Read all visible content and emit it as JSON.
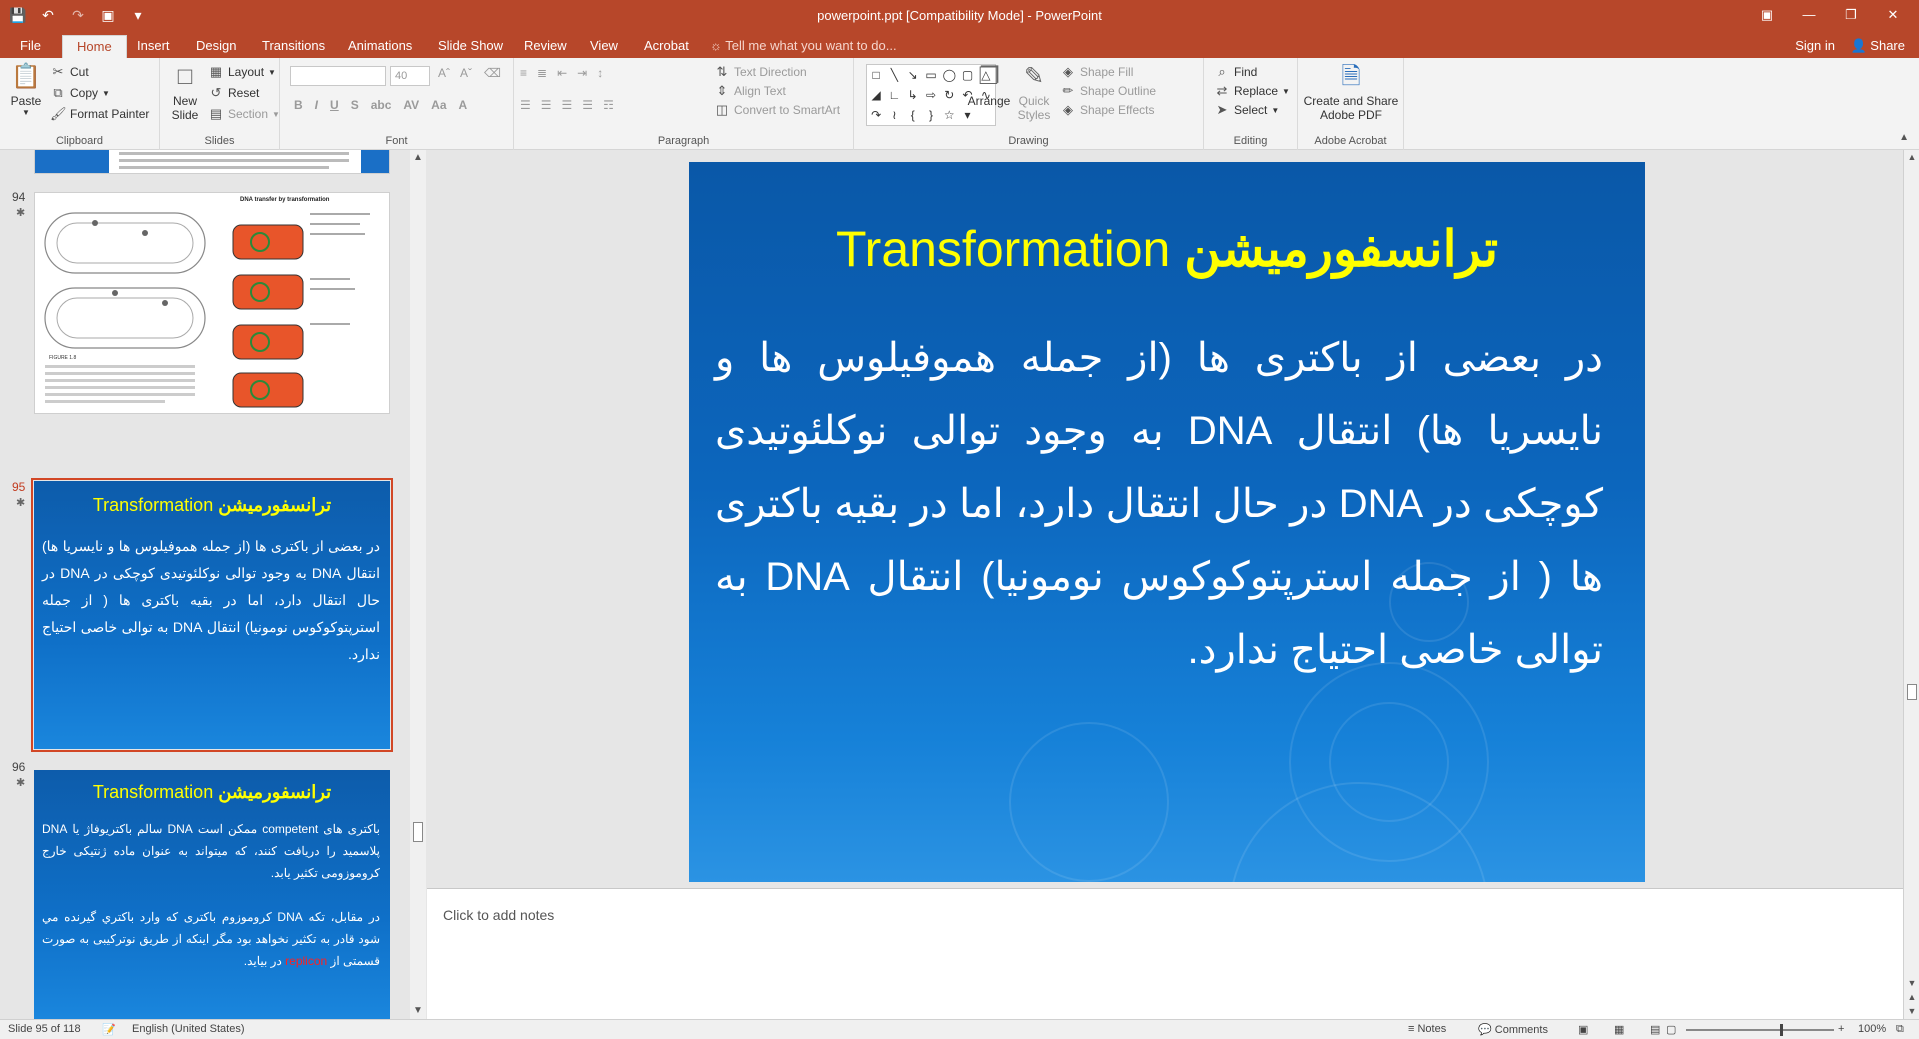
{
  "window": {
    "title": "powerpoint.ppt [Compatibility Mode] - PowerPoint",
    "qat": [
      "save-icon",
      "undo-icon",
      "redo-icon",
      "slideshow-icon",
      "customize-icon"
    ]
  },
  "tabs": {
    "items": [
      "File",
      "Home",
      "Insert",
      "Design",
      "Transitions",
      "Animations",
      "Slide Show",
      "Review",
      "View",
      "Acrobat"
    ],
    "active": "Home",
    "tell_me": "Tell me what you want to do...",
    "sign_in": "Sign in",
    "share": "Share"
  },
  "ribbon": {
    "clipboard": {
      "label": "Clipboard",
      "paste": "Paste",
      "cut": "Cut",
      "copy": "Copy",
      "format_painter": "Format Painter"
    },
    "slides": {
      "label": "Slides",
      "new_slide_line1": "New",
      "new_slide_line2": "Slide",
      "layout": "Layout",
      "reset": "Reset",
      "section": "Section"
    },
    "font": {
      "label": "Font",
      "font_size": "40"
    },
    "paragraph": {
      "label": "Paragraph",
      "text_direction": "Text Direction",
      "align_text": "Align Text",
      "convert_smartart": "Convert to SmartArt"
    },
    "drawing": {
      "label": "Drawing",
      "arrange": "Arrange",
      "quick_styles_line1": "Quick",
      "quick_styles_line2": "Styles",
      "shape_fill": "Shape Fill",
      "shape_outline": "Shape Outline",
      "shape_effects": "Shape Effects"
    },
    "editing": {
      "label": "Editing",
      "find": "Find",
      "replace": "Replace",
      "select": "Select"
    },
    "acrobat": {
      "label": "Adobe Acrobat",
      "create_line1": "Create and Share",
      "create_line2": "Adobe PDF"
    }
  },
  "thumbnails": {
    "slide94": {
      "number": "94",
      "title": "DNA transfer by transformation",
      "figure_label": "FIGURE 1.8"
    },
    "slide95": {
      "number": "95",
      "title_fa": "ترانسفورميشن",
      "title_en": "Transformation",
      "body": "در بعضی از باکتری ها (از جمله هموفیلوس ها و نایسریا ها) انتقال DNA به وجود توالی نوکلئوتیدی کوچکی در DNA در حال انتقال دارد، اما در بقیه باکتری ها ( از جمله استرپتوکوکوس نومونیا) انتقال DNA به توالی خاصی احتیاج ندارد."
    },
    "slide96": {
      "number": "96",
      "title_fa": "ترانسفورميشن",
      "title_en": "Transformation",
      "para1": "باکتری های competent ممکن است DNA سالم باکتریوفاژ یا DNA پلاسمید را دریافت کنند، که میتواند به عنوان ماده ژنتیکی خارج کروموزومی تکثیر یابد.",
      "para2_before": "در مقابل، تکه DNA کروموزوم باکتری که وارد باکتري گیرنده مي شود قادر به تکثیر نخواهد بود مگر اینکه از طریق نوترکیبی به صورت قسمتی از",
      "para2_red": "replicon",
      "para2_after": "در بیاید."
    }
  },
  "slide": {
    "title_fa": "ترانسفورميشن",
    "title_en": "Transformation",
    "body": "در بعضی از باکتری ها (از جمله هموفیلوس ها و نایسریا ها) انتقال DNA به وجود توالی نوکلئوتیدی کوچکی در DNA در حال انتقال دارد، اما در بقیه باکتری ها ( از جمله استرپتوکوکوس نومونیا) انتقال DNA به توالی خاصی احتیاج ندارد."
  },
  "notes": {
    "placeholder": "Click to add notes"
  },
  "status": {
    "slide_info": "Slide 95 of 118",
    "language": "English (United States)",
    "notes": "Notes",
    "comments": "Comments",
    "zoom": "100%"
  },
  "colors": {
    "accent": "#b7472a",
    "title_yellow": "#ffff00",
    "slide_blue": "#0c66bd",
    "selection": "#d24726"
  }
}
